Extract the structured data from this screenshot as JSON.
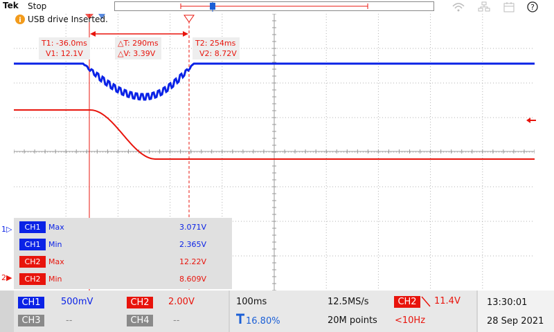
{
  "header": {
    "brand": "Tek",
    "status": "Stop"
  },
  "notification": {
    "text": "USB drive Inserted."
  },
  "colors": {
    "ch1": "#0a22e6",
    "ch2": "#e8140c",
    "grid": "#b0b0b0"
  },
  "cursors": {
    "t1": "T1: -36.0ms",
    "v1": "V1: 12.1V",
    "dt": "△T: 290ms",
    "dv": "△V: 3.39V",
    "t2": "T2: 254ms",
    "v2": "V2: 8.72V"
  },
  "channel_markers": {
    "ch1": "1",
    "ch2": "2"
  },
  "measurements": [
    {
      "channel": "CH1",
      "type": "Max",
      "value": "3.071V",
      "color": "#0a22e6"
    },
    {
      "channel": "CH1",
      "type": "Min",
      "value": "2.365V",
      "color": "#0a22e6"
    },
    {
      "channel": "CH2",
      "type": "Max",
      "value": "12.22V",
      "color": "#e8140c"
    },
    {
      "channel": "CH2",
      "type": "Min",
      "value": "8.609V",
      "color": "#e8140c"
    }
  ],
  "bottom": {
    "ch1_label": "CH1",
    "ch1_scale": "500mV",
    "ch2_label": "CH2",
    "ch2_scale": "2.00V",
    "ch3_label": "CH3",
    "ch3_scale": "--",
    "ch4_label": "CH4",
    "ch4_scale": "--",
    "timebase": "100ms",
    "trigger_pos": "16.80%",
    "sample_rate": "12.5MS/s",
    "record_length": "20M points",
    "trigger_source": "CH2",
    "trigger_level": "11.4V",
    "trigger_freq": "<10Hz",
    "time": "13:30:01",
    "date": "28 Sep 2021"
  },
  "icons": [
    "info-icon",
    "wifi-icon",
    "network-icon",
    "calendar-icon",
    "help-icon"
  ]
}
